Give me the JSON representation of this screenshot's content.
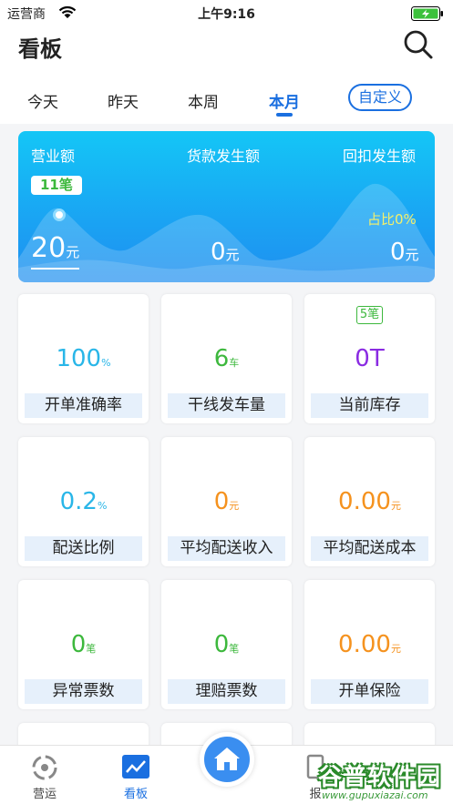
{
  "status_bar": {
    "carrier": "运营商",
    "time": "上午9:16"
  },
  "header": {
    "title": "看板"
  },
  "tabs": [
    {
      "label": "今天"
    },
    {
      "label": "昨天"
    },
    {
      "label": "本周"
    },
    {
      "label": "本月",
      "active": true
    },
    {
      "label": "自定义"
    }
  ],
  "hero": {
    "revenue_label": "营业额",
    "goods_label": "货款发生额",
    "rebate_label": "回扣发生额",
    "order_badge": "11笔",
    "revenue_value": "20",
    "revenue_unit": "元",
    "goods_value": "0",
    "goods_unit": "元",
    "rebate_value": "0",
    "rebate_unit": "元",
    "ratio": "占比0%"
  },
  "cards": [
    {
      "value": "100",
      "unit": "%",
      "label": "开单准确率",
      "color": "#29b6e8"
    },
    {
      "value": "6",
      "unit": "车",
      "label": "干线发车量",
      "color": "#3db83d"
    },
    {
      "value": "0T",
      "unit": "",
      "label": "当前库存",
      "color": "#8a2be2",
      "badge": "5笔"
    },
    {
      "value": "0.2",
      "unit": "%",
      "label": "配送比例",
      "color": "#29b6e8"
    },
    {
      "value": "0",
      "unit": "元",
      "label": "平均配送收入",
      "color": "#f5921e"
    },
    {
      "value": "0.00",
      "unit": "元",
      "label": "平均配送成本",
      "color": "#f5921e"
    },
    {
      "value": "0",
      "unit": "笔",
      "label": "异常票数",
      "color": "#3db83d"
    },
    {
      "value": "0",
      "unit": "笔",
      "label": "理赔票数",
      "color": "#3db83d"
    },
    {
      "value": "0.00",
      "unit": "元",
      "label": "开单保险",
      "color": "#f5921e"
    }
  ],
  "tab_bar": [
    {
      "label": "营运",
      "icon": "operations-icon"
    },
    {
      "label": "看板",
      "icon": "dashboard-icon",
      "active": true
    },
    {
      "label": "",
      "icon": "home-icon"
    },
    {
      "label": "报",
      "icon": "report-icon"
    }
  ],
  "colors": {
    "accent": "#1a6fe0",
    "hero_top": "#14c6f6",
    "hero_bottom": "#1f8ff0"
  },
  "watermark": {
    "main": "谷普软件园",
    "url": "www.gupuxiazai.com"
  }
}
